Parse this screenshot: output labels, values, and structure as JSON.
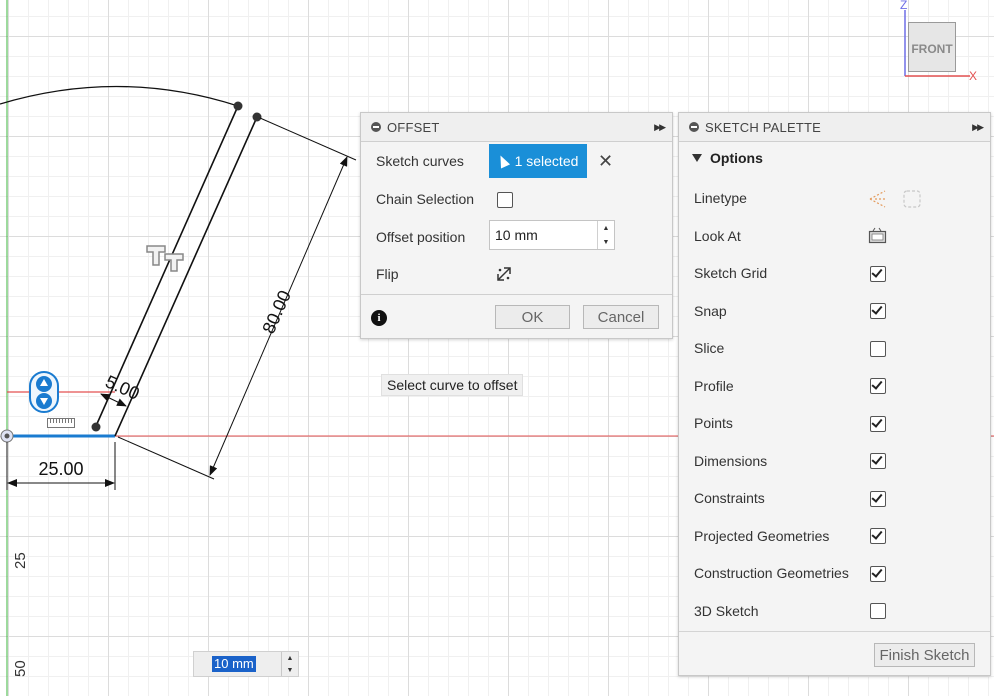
{
  "viewcube": {
    "face_label": "FRONT",
    "z_label": "Z",
    "x_label": "X"
  },
  "sketch": {
    "dimensions": {
      "horizontal": "25.00",
      "offset": "5.00",
      "length": "80.00"
    },
    "axis_ticks": {
      "v25": "25",
      "v50": "50"
    },
    "colors": {
      "construction_axis": "#e35050",
      "vertical_axis": "#3bb33b",
      "selected_line": "#1a7bd0"
    }
  },
  "offset_panel": {
    "title": "OFFSET",
    "sketch_curves_label": "Sketch curves",
    "selected_text": "1 selected",
    "clear_icon": "close-icon",
    "chain_selection_label": "Chain Selection",
    "chain_selection_checked": false,
    "offset_position_label": "Offset position",
    "offset_position_value": "10 mm",
    "flip_label": "Flip",
    "ok_label": "OK",
    "cancel_label": "Cancel"
  },
  "tooltip": {
    "text": "Select curve to offset"
  },
  "palette": {
    "title": "SKETCH PALETTE",
    "section": "Options",
    "options": [
      {
        "label": "Linetype",
        "control": "linetype-icons"
      },
      {
        "label": "Look At",
        "control": "look-at-icon"
      },
      {
        "label": "Sketch Grid",
        "checked": true
      },
      {
        "label": "Snap",
        "checked": true
      },
      {
        "label": "Slice",
        "checked": false
      },
      {
        "label": "Profile",
        "checked": true
      },
      {
        "label": "Points",
        "checked": true
      },
      {
        "label": "Dimensions",
        "checked": true
      },
      {
        "label": "Constraints",
        "checked": true
      },
      {
        "label": "Projected Geometries",
        "checked": true
      },
      {
        "label": "Construction Geometries",
        "checked": true
      },
      {
        "label": "3D Sketch",
        "checked": false
      }
    ],
    "finish_label": "Finish Sketch"
  },
  "bottom_input": {
    "value": "10 mm"
  }
}
